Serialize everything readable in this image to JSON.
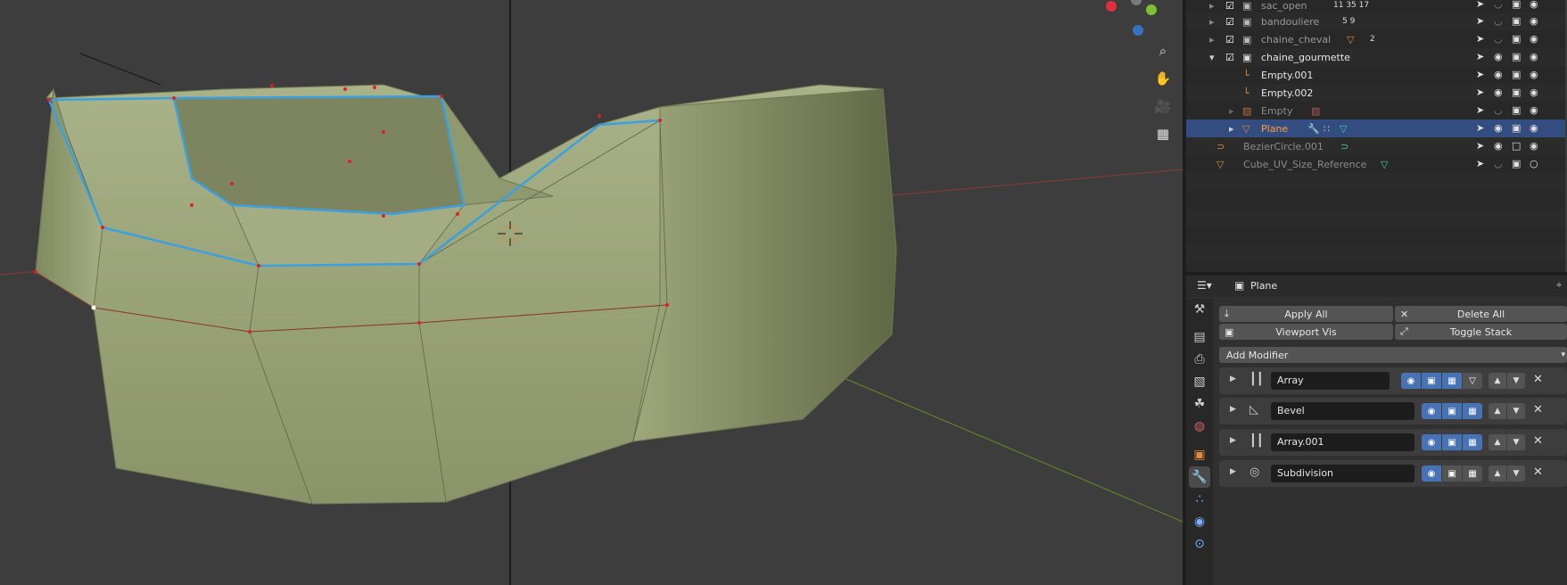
{
  "outliner": {
    "rows": [
      {
        "label": "sac_open",
        "badges": "11  35  17"
      },
      {
        "label": "bandouliere",
        "badges": "5   9"
      },
      {
        "label": "chaine_cheval",
        "badges": "2"
      },
      {
        "label": "chaine_gourmette",
        "badges": ""
      },
      {
        "label": "Empty.001",
        "badges": ""
      },
      {
        "label": "Empty.002",
        "badges": ""
      },
      {
        "label": "Empty",
        "badges": ""
      },
      {
        "label": "Plane",
        "badges": ""
      },
      {
        "label": "BezierCircle.001",
        "badges": ""
      },
      {
        "label": "Cube_UV_Size_Reference",
        "badges": ""
      }
    ]
  },
  "properties": {
    "object_name": "Plane",
    "apply_all": "Apply All",
    "delete_all": "Delete All",
    "viewport_vis": "Viewport Vis",
    "toggle_stack": "Toggle Stack",
    "add_modifier": "Add Modifier",
    "modifiers": [
      {
        "name": "Array"
      },
      {
        "name": "Bevel"
      },
      {
        "name": "Array.001"
      },
      {
        "name": "Subdivision"
      }
    ]
  },
  "icons": {
    "zoom": "magnifier-icon",
    "pan": "hand-icon",
    "camera": "camera-icon",
    "ortho": "grid-icon"
  },
  "colors": {
    "mesh": "#9aa478",
    "selection_edge": "#3aa0e0",
    "vertex": "#e02020",
    "selected_row": "#334d80",
    "toggle_on": "#4772b3"
  }
}
